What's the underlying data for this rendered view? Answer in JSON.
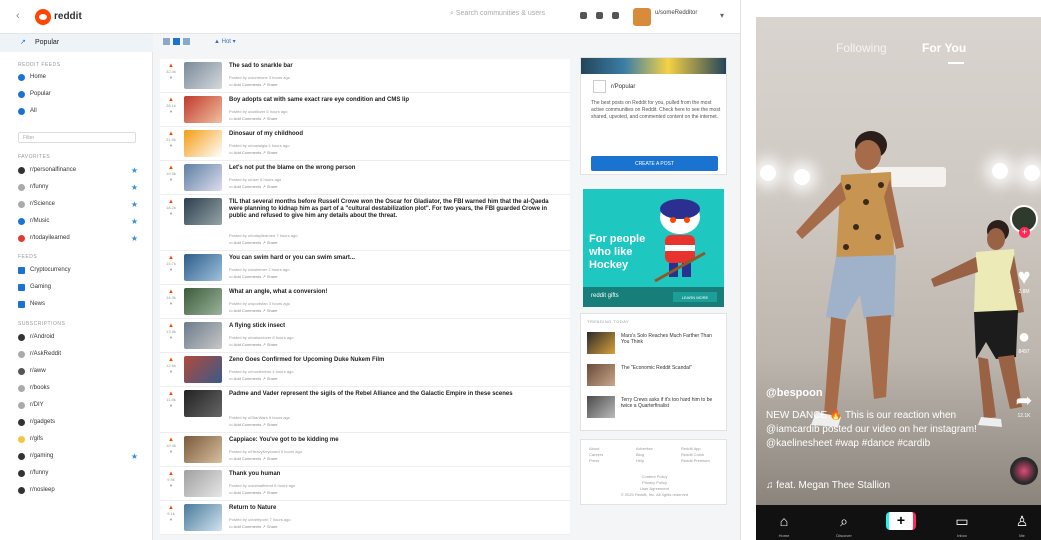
{
  "reddit": {
    "logo_text": "reddit",
    "search_placeholder": "Search communities & users",
    "username": "u/someRedditor",
    "popular_tab": "Popular",
    "sections": {
      "reddit_feeds": "REDDIT FEEDS",
      "favorites": "FAVORITES",
      "feeds": "FEEDS",
      "subscriptions": "SUBSCRIPTIONS"
    },
    "feeds": [
      "Home",
      "Popular",
      "All"
    ],
    "filter_placeholder": "Filter",
    "favorites": [
      "r/personalfinance",
      "r/funny",
      "r/Science",
      "r/Music",
      "r/todayilearned"
    ],
    "custom_feeds": [
      "Cryptocurrency",
      "Gaming",
      "News"
    ],
    "subscriptions": [
      "r/Android",
      "r/AskReddit",
      "r/aww",
      "r/books",
      "r/DIY",
      "r/gadgets",
      "r/gifs",
      "r/gaming",
      "r/funny",
      "r/nosleep"
    ],
    "sort_label": "Hot",
    "posts": [
      {
        "title": "The sad to snarkle bar",
        "meta": "Posted by u/someone 3 hours ago",
        "comments": "Add Comments",
        "share": "Share",
        "votes": "32.4k"
      },
      {
        "title": "Boy adopts cat with same exact rare eye condition and CMS lip",
        "meta": "Posted by u/catlover 5 hours ago",
        "comments": "Add Comments",
        "share": "Share",
        "votes": "28.1k"
      },
      {
        "title": "Dinosaur of my childhood",
        "meta": "Posted by u/nostalgia 4 hours ago",
        "comments": "Add Comments",
        "share": "Share",
        "votes": "21.9k"
      },
      {
        "title": "Let's not put the blame on the wrong person",
        "meta": "Posted by u/user 6 hours ago",
        "comments": "Add Comments",
        "share": "Share",
        "votes": "19.5k"
      },
      {
        "title": "TIL that several months before Russell Crowe won the Oscar for Gladiator, the FBI warned him that the al-Qaeda were planning to kidnap him as part of a \"cultural destabilization plot\". For two years, the FBI guarded Crowe in public and refused to give him any details about the threat.",
        "meta": "Posted by u/todayilearned 7 hours ago",
        "comments": "Add Comments",
        "share": "Share",
        "votes": "18.2k"
      },
      {
        "title": "You can swim hard or you can swim smart...",
        "meta": "Posted by u/swimmer 2 hours ago",
        "comments": "Add Comments",
        "share": "Share",
        "votes": "15.7k"
      },
      {
        "title": "What an angle, what a conversion!",
        "meta": "Posted by u/sportsfan 3 hours ago",
        "comments": "Add Comments",
        "share": "Share",
        "votes": "14.3k"
      },
      {
        "title": "A flying stick insect",
        "meta": "Posted by u/naturelover 8 hours ago",
        "comments": "Add Comments",
        "share": "Share",
        "votes": "13.9k"
      },
      {
        "title": "Zeno Goes Confirmed for Upcoming Duke Nukem Film",
        "meta": "Posted by u/movienews 4 hours ago",
        "comments": "Add Comments",
        "share": "Share",
        "votes": "12.6k"
      },
      {
        "title": "Padme and Vader represent the sigils of the Rebel Alliance and the Galactic Empire in these scenes",
        "meta": "Posted by u/StarWars 9 hours ago",
        "comments": "Add Comments",
        "share": "Share",
        "votes": "11.8k"
      },
      {
        "title": "Cappiace: You've got to be kidding me",
        "meta": "Posted by u/HeavyKeyboard 5 hours ago",
        "comments": "Add Comments",
        "share": "Share",
        "votes": "10.4k"
      },
      {
        "title": "Thank you human",
        "meta": "Posted by u/animalfriend 6 hours ago",
        "comments": "Add Comments",
        "share": "Share",
        "votes": "9.9k"
      },
      {
        "title": "Return to Nature",
        "meta": "Posted by u/earthporn 7 hours ago",
        "comments": "Add Comments",
        "share": "Share",
        "votes": "9.1k"
      }
    ],
    "popular_card": {
      "name": "r/Popular",
      "description": "The best posts on Reddit for you, pulled from the most active communities on Reddit. Check here to see the most shared, upvoted, and commented content on the internet.",
      "button": "CREATE A POST"
    },
    "ad": {
      "text": "For people who like Hockey",
      "logo": "reddit gifts",
      "button": "LEARN MORE"
    },
    "trending": {
      "header": "TRENDING TODAY",
      "items": [
        "Mars's Solo Reaches Much Farther Than You Think",
        "The \"Economic Reddit Scandal\"",
        "Terry Crews asks if it's too hard him to be twice a Quarterfinalist"
      ]
    },
    "footer": [
      "About",
      "Careers",
      "Press",
      "Advertise",
      "Blog",
      "Help",
      "Reddit App",
      "Reddit Coins",
      "Reddit Premium",
      "Content Policy",
      "Privacy Policy",
      "User Agreement",
      "© 2020 Reddit, Inc. All rights reserved"
    ]
  },
  "tiktok": {
    "tab_following": "Following",
    "tab_for_you": "For You",
    "likes": "2.8M",
    "comments": "8497",
    "shares": "12.1K",
    "username": "@bespoon",
    "caption": "NEW DANCE 🔥 This is our reaction when @iamcardib posted our video on her instagram! @kaelinesheet #wap #dance #cardib",
    "music": "♫ feat. Megan Thee Stallion",
    "nav": [
      "Home",
      "Discover",
      "",
      "Inbox",
      "Me"
    ]
  }
}
